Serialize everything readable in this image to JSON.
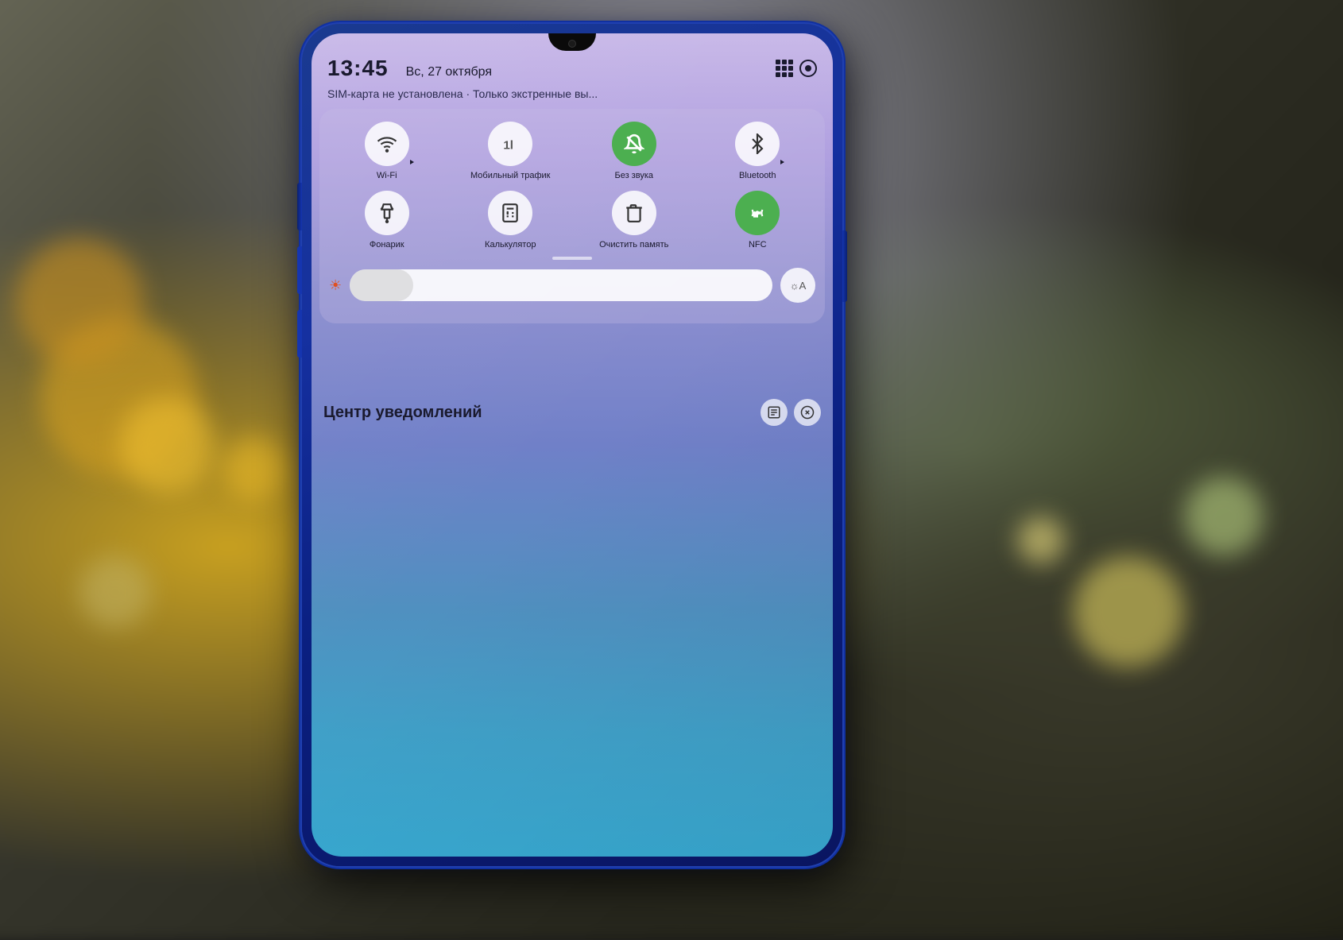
{
  "background": {
    "description": "Blurred bokeh outdoor scene"
  },
  "phone": {
    "screen": {
      "statusBar": {
        "time": "13:45",
        "date": "Вс, 27 октября",
        "simText": "SIM-карта не установлена · Только экстренные вы..."
      },
      "quickSettings": {
        "row1": [
          {
            "id": "wifi",
            "label": "Wi-Fi",
            "active": false,
            "hasArrow": true
          },
          {
            "id": "mobile",
            "label": "Мобильный трафик",
            "active": false,
            "hasArrow": false
          },
          {
            "id": "silent",
            "label": "Без звука",
            "active": true,
            "hasArrow": false
          },
          {
            "id": "bluetooth",
            "label": "Bluetooth",
            "active": false,
            "hasArrow": true
          }
        ],
        "row2": [
          {
            "id": "flashlight",
            "label": "Фонарик",
            "active": false
          },
          {
            "id": "calculator",
            "label": "Калькулятор",
            "active": false
          },
          {
            "id": "clearmem",
            "label": "Очистить память",
            "active": false
          },
          {
            "id": "nfc",
            "label": "NFC",
            "active": true
          }
        ]
      },
      "brightness": {
        "value": 15,
        "autoLabel": "☼A"
      },
      "notificationCenter": {
        "title": "Центр уведомлений"
      }
    }
  }
}
